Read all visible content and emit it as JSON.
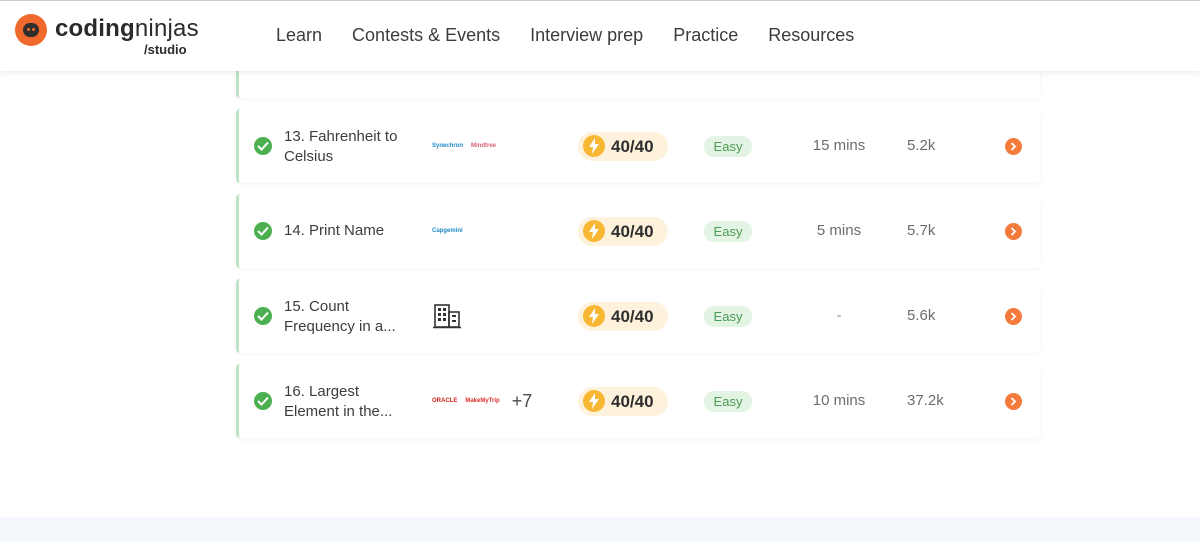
{
  "brand": {
    "name_part1": "coding",
    "name_part2": "ninjas",
    "sub": "/studio"
  },
  "nav": [
    {
      "label": "Learn"
    },
    {
      "label": "Contests & Events"
    },
    {
      "label": "Interview prep"
    },
    {
      "label": "Practice"
    },
    {
      "label": "Resources"
    }
  ],
  "problems": [
    {
      "title": "13. Fahrenheit to Celsius",
      "companies": [
        "Synechron",
        "Mindtree"
      ],
      "score": "40/40",
      "difficulty": "Easy",
      "time": "15 mins",
      "count": "5.2k"
    },
    {
      "title": "14. Print Name",
      "companies": [
        "Capgemini"
      ],
      "score": "40/40",
      "difficulty": "Easy",
      "time": "5 mins",
      "count": "5.7k"
    },
    {
      "title": "15. Count Frequency in a...",
      "companies": [],
      "company_icon": "building-icon",
      "score": "40/40",
      "difficulty": "Easy",
      "time": "-",
      "count": "5.6k"
    },
    {
      "title": "16. Largest Element in the...",
      "companies": [
        "ORACLE",
        "MakeMyTrip"
      ],
      "more_companies": "+7",
      "score": "40/40",
      "difficulty": "Easy",
      "time": "10 mins",
      "count": "37.2k"
    }
  ],
  "colors": {
    "brand_orange": "#f16a2d",
    "success_green": "#4caf50",
    "score_bg": "#fff2dc",
    "bolt": "#f7b733",
    "easy_bg": "#e3f3e4",
    "easy_text": "#4c9c55"
  }
}
